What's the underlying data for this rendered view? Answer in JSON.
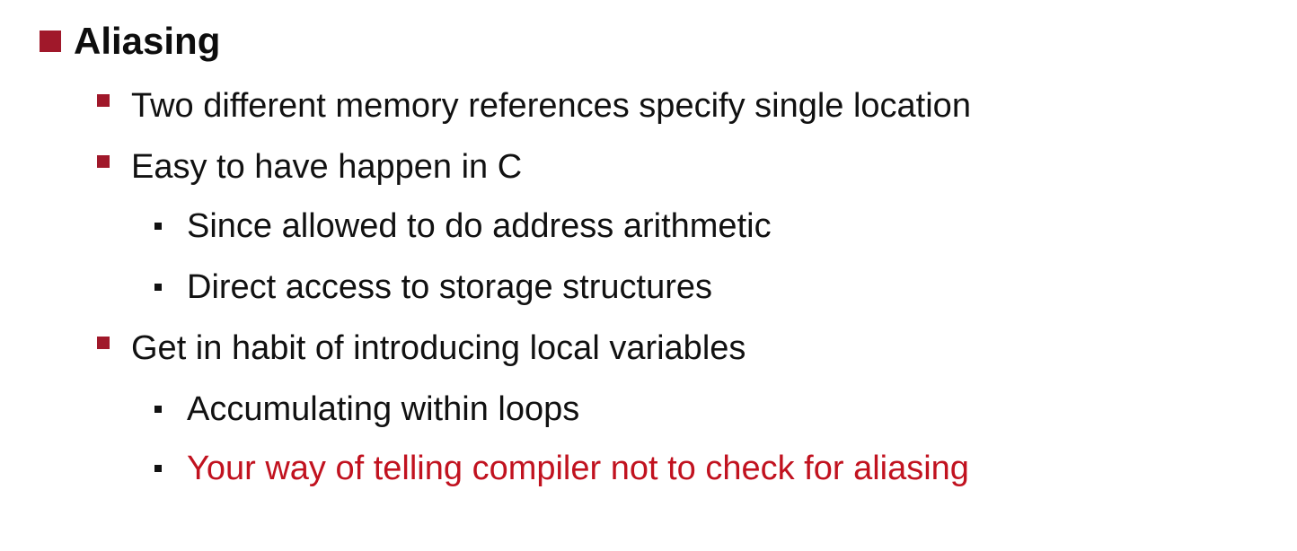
{
  "slide": {
    "title": "Aliasing",
    "bullets": [
      {
        "level": 1,
        "text": "Two different memory references specify single location"
      },
      {
        "level": 1,
        "text": "Easy to have happen in C"
      },
      {
        "level": 2,
        "text": "Since allowed to do address arithmetic"
      },
      {
        "level": 2,
        "text": "Direct access to storage structures"
      },
      {
        "level": 1,
        "text": "Get in habit of introducing local variables"
      },
      {
        "level": 2,
        "text": "Accumulating within loops"
      },
      {
        "level": 2,
        "text": "Your way of telling compiler not to check for aliasing",
        "color": "#c1121f"
      }
    ]
  },
  "colors": {
    "bullet_accent": "#a0182a",
    "emphasis_text": "#c1121f",
    "body_text": "#111111"
  }
}
